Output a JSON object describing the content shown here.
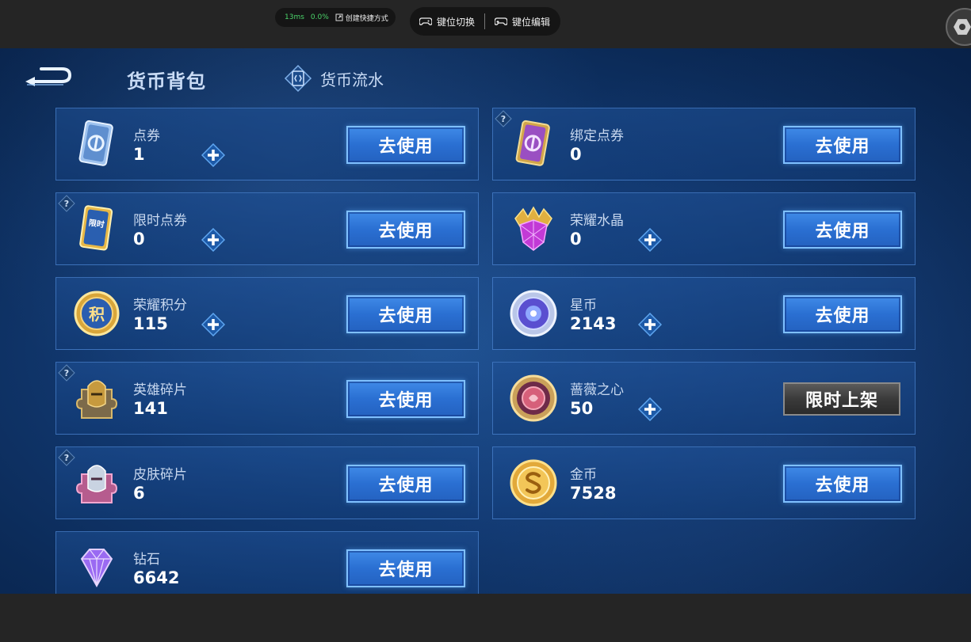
{
  "overlay": {
    "latency": "13ms",
    "cpu": "0.0%",
    "shortcut_label": "创建快捷方式",
    "keymap_switch": "键位切换",
    "keymap_edit": "键位编辑"
  },
  "header": {
    "title": "货币背包",
    "flow_tab": "货币流水"
  },
  "buttons": {
    "use": "去使用",
    "limited": "限时上架"
  },
  "currencies": [
    {
      "name": "点券",
      "value": "1"
    },
    {
      "name": "绑定点券",
      "value": "0"
    },
    {
      "name": "限时点券",
      "value": "0"
    },
    {
      "name": "荣耀水晶",
      "value": "0"
    },
    {
      "name": "荣耀积分",
      "value": "115"
    },
    {
      "name": "星币",
      "value": "2143"
    },
    {
      "name": "英雄碎片",
      "value": "141"
    },
    {
      "name": "蔷薇之心",
      "value": "50"
    },
    {
      "name": "皮肤碎片",
      "value": "6"
    },
    {
      "name": "金币",
      "value": "7528"
    },
    {
      "name": "钻石",
      "value": "6642"
    }
  ],
  "icon_labels": {
    "limited_voucher": "限时",
    "glory_points": "积"
  }
}
